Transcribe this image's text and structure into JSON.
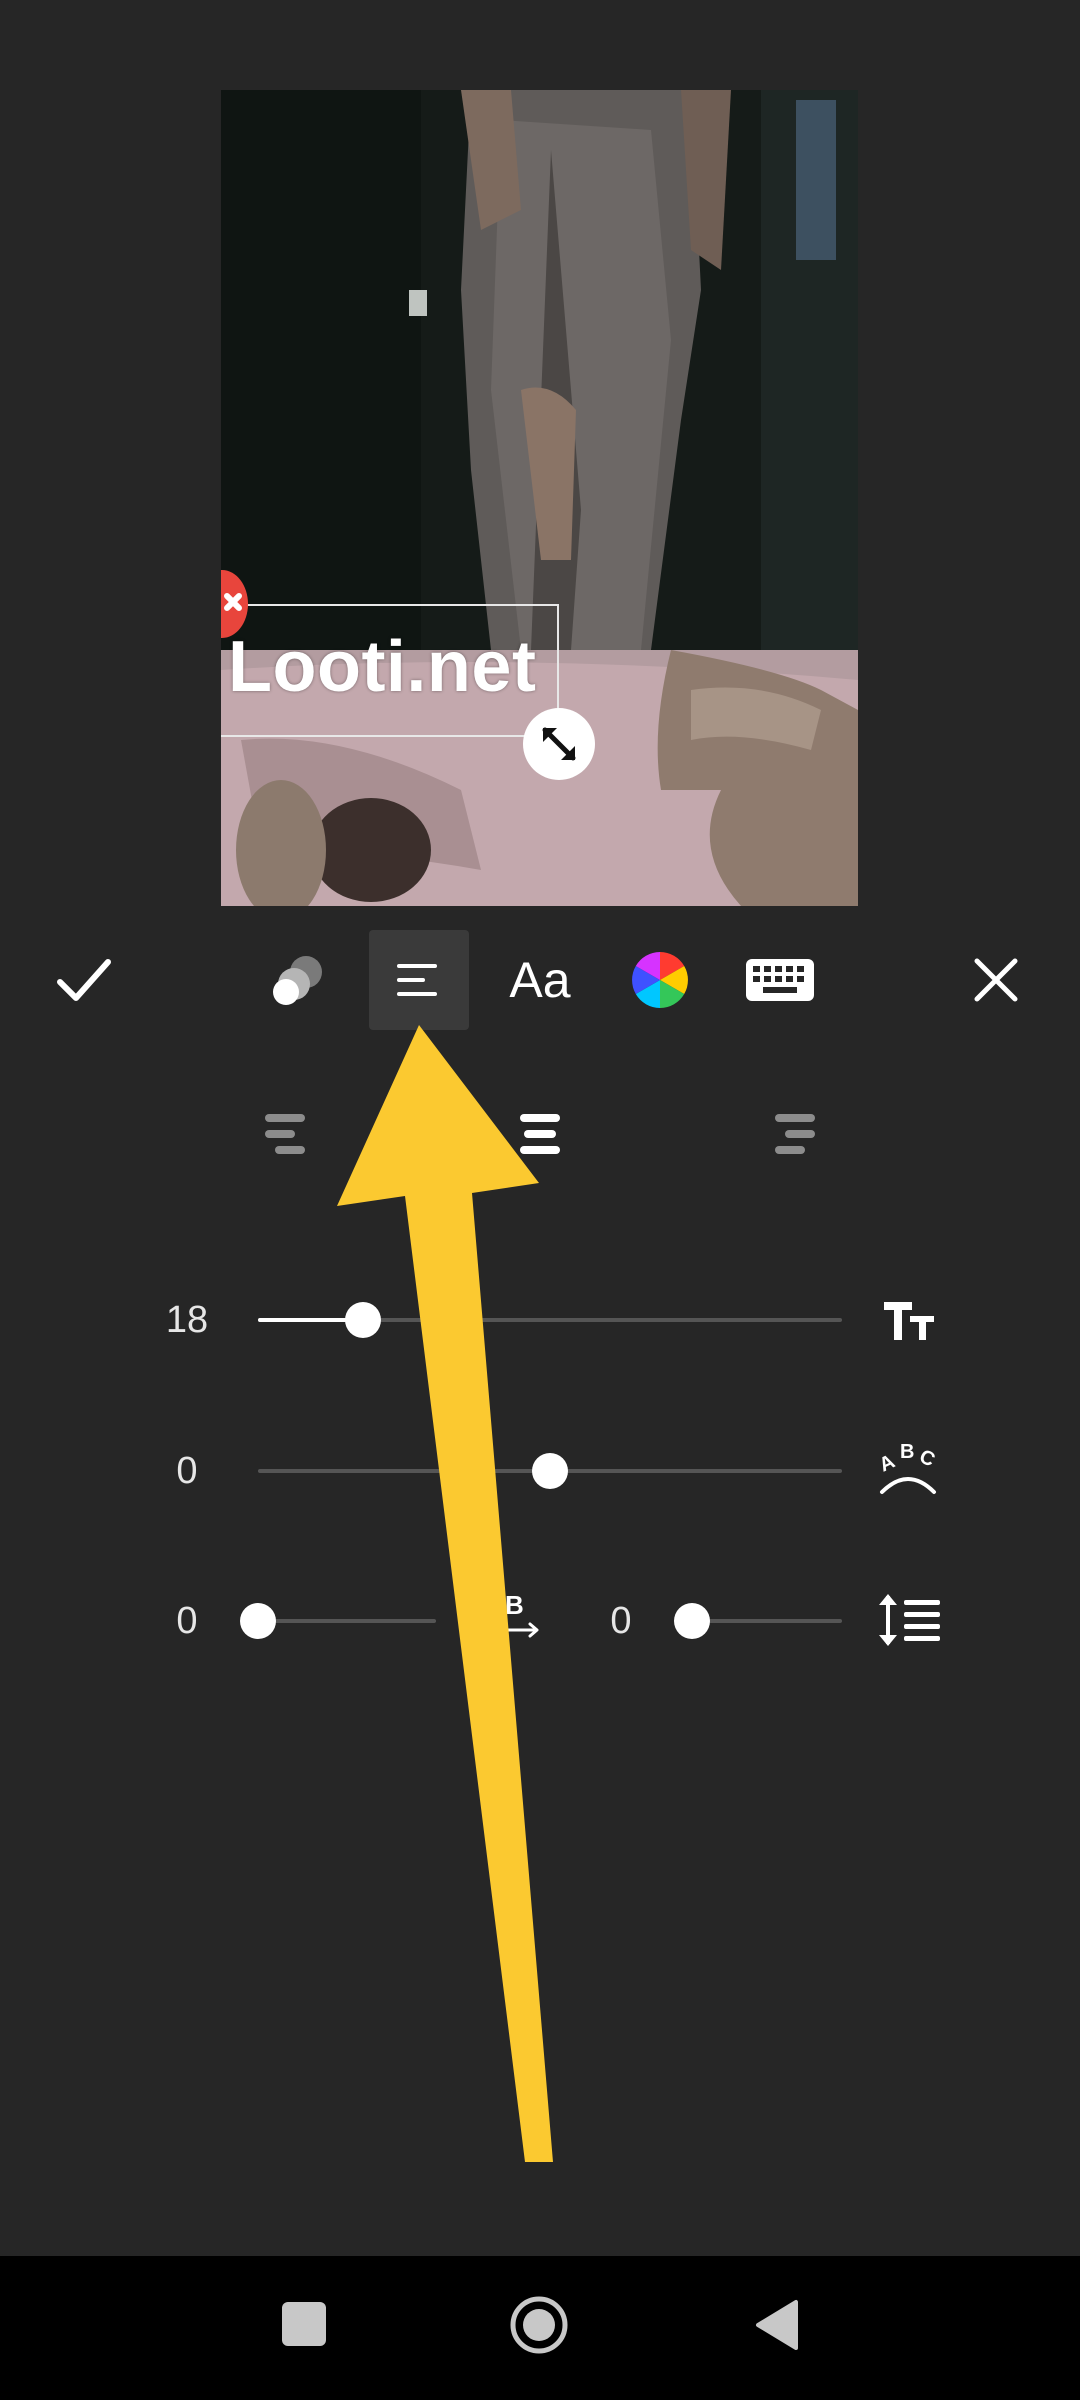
{
  "preview": {
    "overlay_text": "Looti.net"
  },
  "toolbar": {
    "items": [
      {
        "id": "confirm",
        "icon": "checkmark-icon"
      },
      {
        "id": "opacity",
        "icon": "opacity-circles-icon"
      },
      {
        "id": "alignment",
        "icon": "align-left-icon",
        "selected": true
      },
      {
        "id": "font",
        "label": "Aa"
      },
      {
        "id": "color",
        "icon": "color-wheel-icon"
      },
      {
        "id": "keyboard",
        "icon": "keyboard-icon"
      },
      {
        "id": "close",
        "icon": "close-icon"
      }
    ]
  },
  "alignment_options": [
    {
      "id": "left",
      "icon": "align-left-icon"
    },
    {
      "id": "center",
      "icon": "align-center-icon",
      "selected": true
    },
    {
      "id": "right",
      "icon": "align-right-icon"
    }
  ],
  "sliders": {
    "font_size": {
      "value": "18",
      "icon": "text-size-icon",
      "fraction": 0.18
    },
    "curve": {
      "value": "0",
      "icon": "text-curve-icon",
      "fraction": 0.5
    },
    "letter_spacing": {
      "value": "0",
      "icon": "letter-spacing-icon",
      "fraction": 0.0
    },
    "line_spacing": {
      "value": "0",
      "icon": "line-spacing-icon",
      "fraction": 0.0
    }
  },
  "annotation": {
    "color": "#fbc930"
  },
  "colors": {
    "background": "#262626",
    "accent_delete": "#e8453c",
    "selected_tool_bg": "#3a3a3a"
  },
  "nav_bar": {
    "items": [
      "recents-button",
      "home-button",
      "back-button"
    ]
  }
}
